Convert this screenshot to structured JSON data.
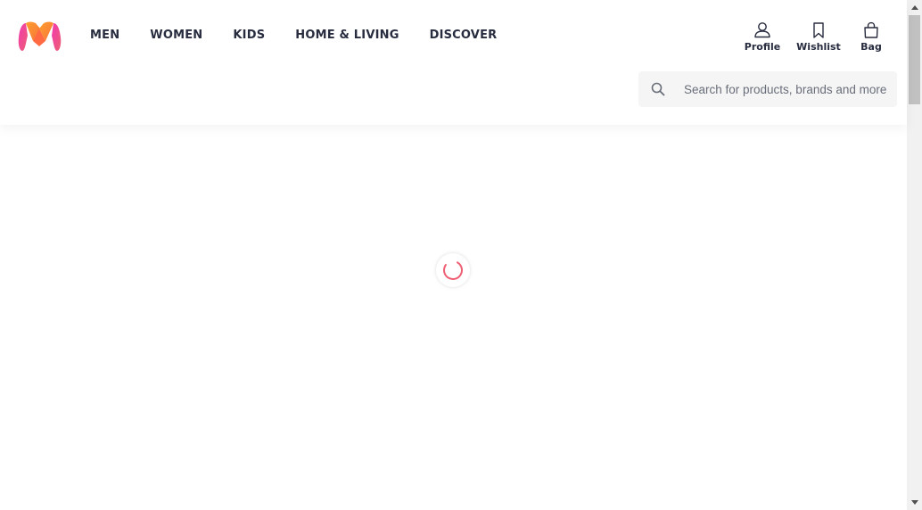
{
  "header": {
    "logo_name": "myntra-logo",
    "nav": [
      {
        "label": "MEN"
      },
      {
        "label": "WOMEN"
      },
      {
        "label": "KIDS"
      },
      {
        "label": "HOME & LIVING"
      },
      {
        "label": "DISCOVER"
      }
    ],
    "actions": {
      "profile": "Profile",
      "wishlist": "Wishlist",
      "bag": "Bag"
    },
    "search": {
      "placeholder": "Search for products, brands and more"
    }
  },
  "colors": {
    "brand_pink": "#ff3f6c",
    "brand_orange": "#f89f2d",
    "text": "#282c3f",
    "search_bg": "#f5f5f6"
  },
  "loading": {
    "icon": "loading-spinner-icon"
  }
}
